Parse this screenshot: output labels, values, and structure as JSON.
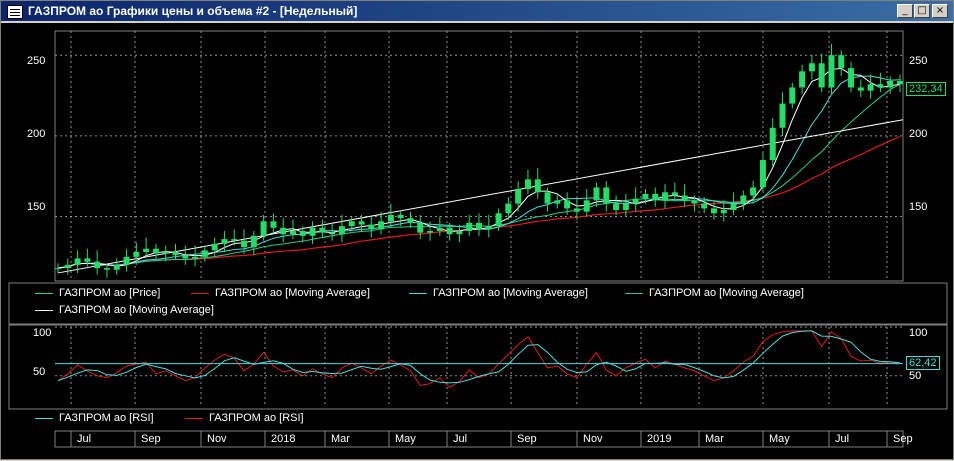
{
  "window": {
    "title": "ГАЗПРОМ ао Графики цены и объема #2 - [Недельный]"
  },
  "buttons": {
    "minimize": "_",
    "maximize": "□",
    "close": "×"
  },
  "colors": {
    "price": "#22dd66",
    "ma_red": "#e01a1a",
    "ma_cyan": "#44dddd",
    "ma_green": "#22cc88",
    "ma_white": "#ffffff",
    "rsi_cyan": "#44dddd",
    "rsi_red": "#e01a1a"
  },
  "price_panel": {
    "y_labels_left": [
      "250",
      "200",
      "150"
    ],
    "y_labels_right": [
      "250",
      "200",
      "150"
    ],
    "last_value": "232,34",
    "legend": [
      {
        "label": "ГАЗПРОМ ао [Price]",
        "color": "#22dd66"
      },
      {
        "label": "ГАЗПРОМ ао [Moving Average]",
        "color": "#e01a1a"
      },
      {
        "label": "ГАЗПРОМ ао [Moving Average]",
        "color": "#44dddd"
      },
      {
        "label": "ГАЗПРОМ ао [Moving Average]",
        "color": "#22cc88"
      },
      {
        "label": "ГАЗПРОМ ао [Moving Average]",
        "color": "#ffffff"
      }
    ]
  },
  "rsi_panel": {
    "y_labels_left": [
      "100",
      "50"
    ],
    "y_labels_right": [
      "100",
      "50"
    ],
    "last_value": "62,42",
    "legend": [
      {
        "label": "ГАЗПРОМ ао [RSI]",
        "color": "#44dddd"
      },
      {
        "label": "ГАЗПРОМ ао [RSI]",
        "color": "#e01a1a"
      }
    ]
  },
  "x_axis": [
    "Jul",
    "Sep",
    "Nov",
    "2018",
    "Mar",
    "May",
    "Jul",
    "Sep",
    "Nov",
    "2019",
    "Mar",
    "May",
    "Jul",
    "Sep"
  ],
  "chart_data": {
    "type": "line",
    "price_close": [
      118,
      120,
      124,
      122,
      118,
      117,
      120,
      125,
      128,
      130,
      127,
      128,
      126,
      124,
      125,
      129,
      133,
      136,
      135,
      131,
      138,
      147,
      143,
      139,
      141,
      138,
      143,
      140,
      139,
      144,
      147,
      145,
      142,
      147,
      151,
      149,
      146,
      140,
      141,
      143,
      139,
      141,
      146,
      142,
      144,
      152,
      158,
      167,
      173,
      165,
      158,
      160,
      155,
      153,
      160,
      168,
      158,
      154,
      158,
      161,
      164,
      160,
      165,
      163,
      160,
      158,
      155,
      152,
      154,
      158,
      163,
      168,
      185,
      205,
      220,
      230,
      240,
      245,
      230,
      250,
      242,
      230,
      228,
      232,
      230,
      234,
      232
    ],
    "rsi": [
      45,
      52,
      61,
      55,
      50,
      48,
      53,
      60,
      62,
      64,
      52,
      55,
      50,
      45,
      48,
      58,
      66,
      72,
      68,
      55,
      62,
      74,
      60,
      54,
      56,
      50,
      57,
      52,
      48,
      58,
      63,
      58,
      52,
      60,
      66,
      61,
      55,
      40,
      42,
      48,
      38,
      44,
      56,
      48,
      52,
      62,
      72,
      82,
      90,
      74,
      58,
      60,
      52,
      48,
      62,
      74,
      56,
      50,
      58,
      63,
      67,
      58,
      65,
      62,
      58,
      55,
      50,
      45,
      48,
      55,
      64,
      70,
      85,
      92,
      95,
      96,
      96,
      96,
      80,
      95,
      88,
      70,
      65,
      66,
      63,
      64,
      62.42
    ],
    "ylim_price": [
      110,
      265
    ],
    "ylim_rsi": [
      20,
      100
    ],
    "last_price": 232.34,
    "last_rsi": 62.42
  }
}
